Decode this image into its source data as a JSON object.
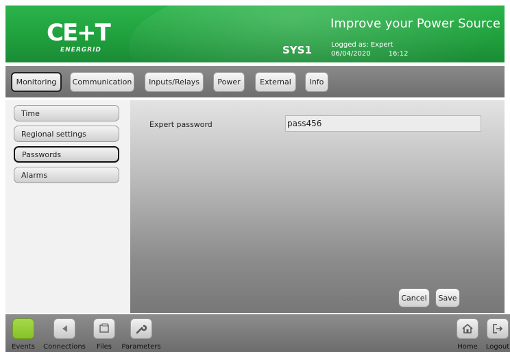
{
  "header": {
    "logo_text": "CE+T",
    "logo_sub": "ENERGRID",
    "tagline": "Improve your Power Source",
    "system": "SYS1",
    "logged_as": "Logged as: Expert",
    "date": "06/04/2020",
    "time": "16:12"
  },
  "tabs": [
    {
      "label": "Monitoring",
      "active": true
    },
    {
      "label": "Communication"
    },
    {
      "label": "Inputs/Relays"
    },
    {
      "label": "Power"
    },
    {
      "label": "External"
    },
    {
      "label": "Info"
    }
  ],
  "sidebar": {
    "items": [
      {
        "label": "Time"
      },
      {
        "label": "Regional settings"
      },
      {
        "label": "Passwords",
        "active": true
      },
      {
        "label": "Alarms"
      }
    ]
  },
  "main": {
    "password_label": "Expert password",
    "password_value": "pass456",
    "cancel_label": "Cancel",
    "save_label": "Save"
  },
  "bottom": {
    "events": "Events",
    "connections": "Connections",
    "files": "Files",
    "parameters": "Parameters",
    "home": "Home",
    "logout": "Logout"
  },
  "icons": {
    "events": "events-icon",
    "connections": "connections-icon",
    "files": "files-icon",
    "parameters": "wrench-icon",
    "home": "home-icon",
    "logout": "logout-icon"
  },
  "colors": {
    "brand_green": "#2bb44a",
    "events_green": "#a6d84a"
  }
}
